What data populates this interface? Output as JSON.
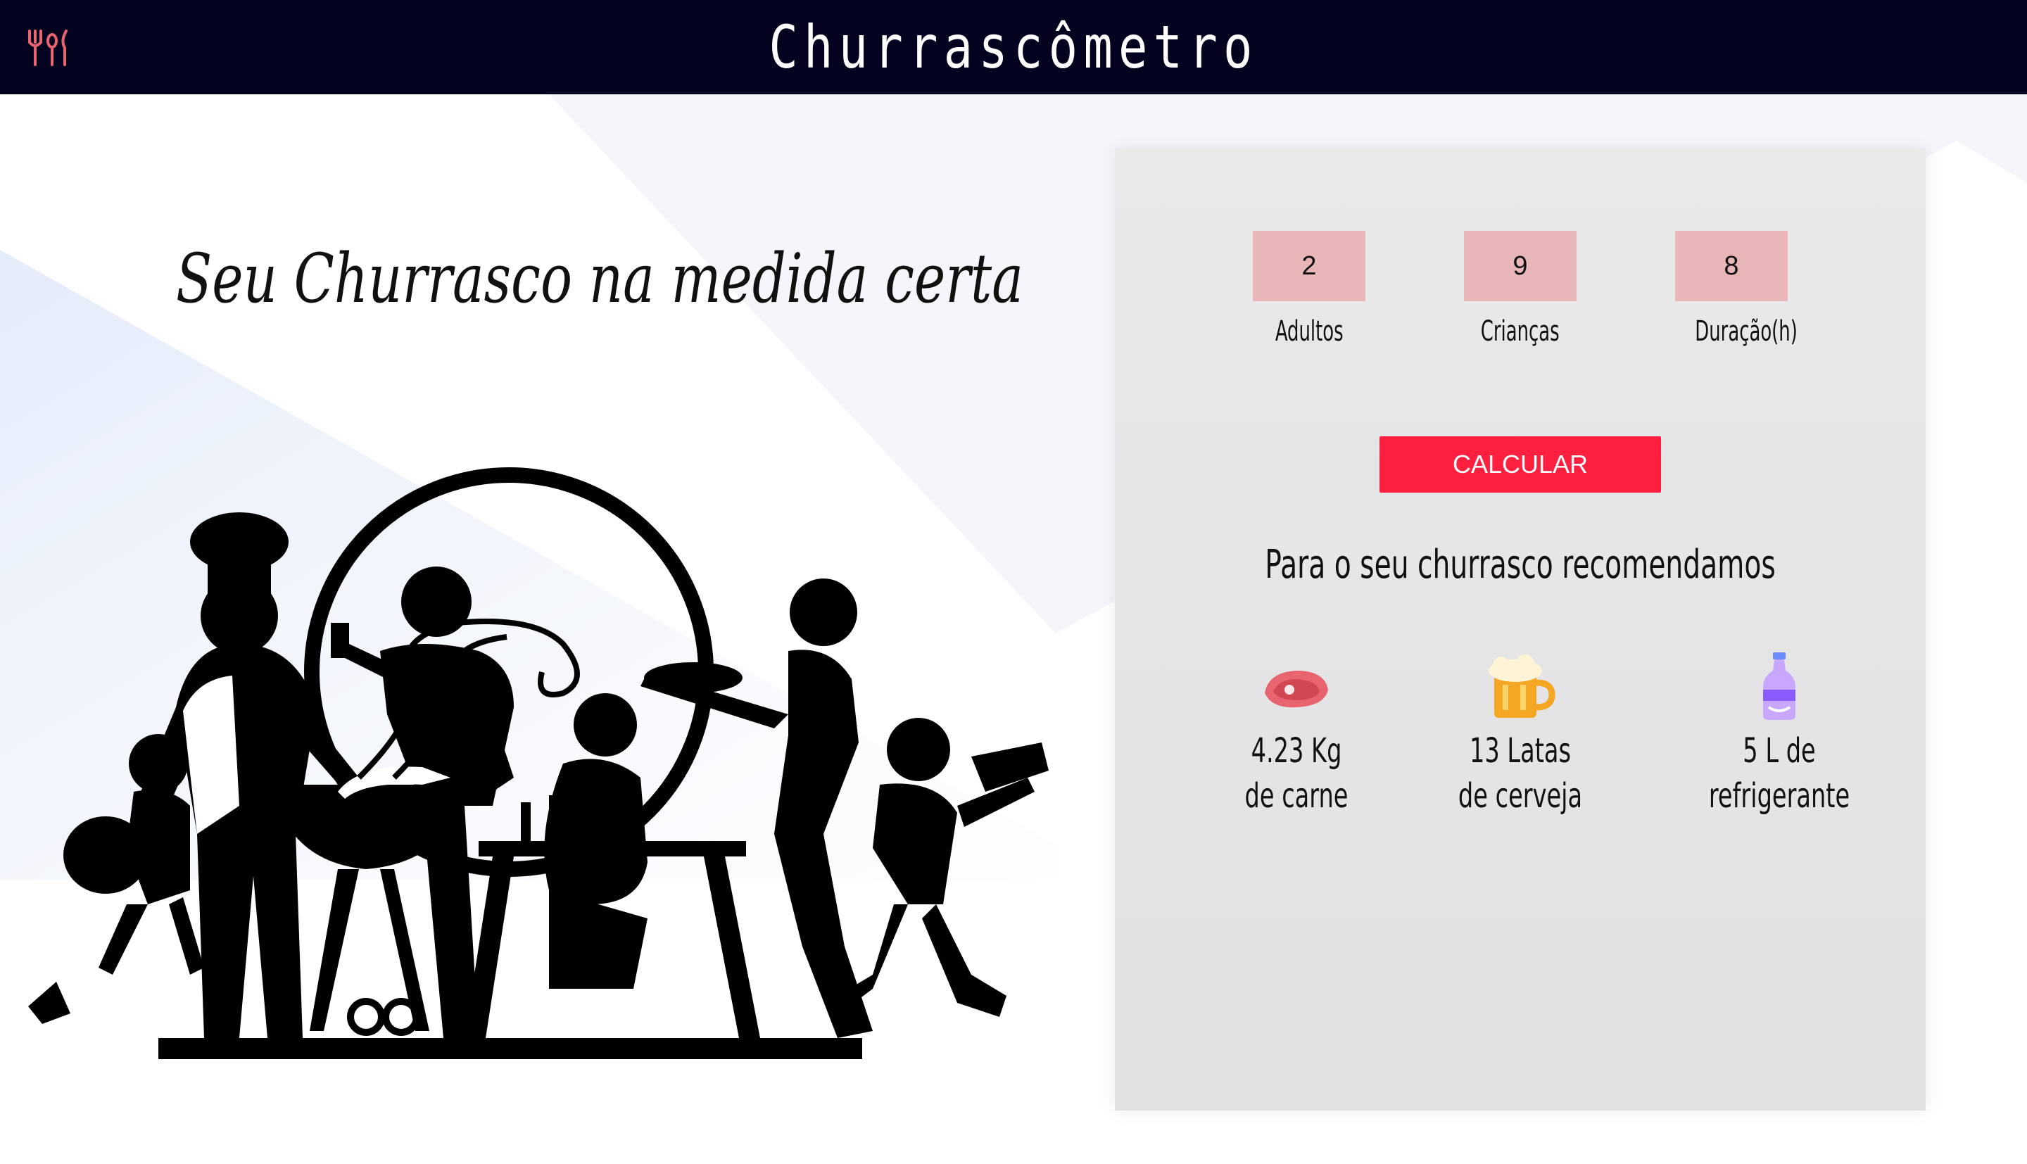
{
  "header": {
    "title": "Churrascômetro",
    "icon": "utensils-icon"
  },
  "hero": {
    "tagline": "Seu Churrasco na medida certa",
    "illustration": "bbq-family-silhouette"
  },
  "calculator": {
    "inputs": [
      {
        "value": "2",
        "label": "Adultos"
      },
      {
        "value": "9",
        "label": "Crianças"
      },
      {
        "value": "8",
        "label": "Duração(h)"
      }
    ],
    "button_label": "CALCULAR",
    "recommend_title": "Para o seu churrasco recomendamos",
    "results": [
      {
        "icon": "meat-icon",
        "line1": "4.23 Kg",
        "line2": "de carne"
      },
      {
        "icon": "beer-mug-icon",
        "line1": "13 Latas",
        "line2": "de cerveja"
      },
      {
        "icon": "soda-bottle-icon",
        "line1": "5 L de",
        "line2": "refrigerante"
      }
    ]
  },
  "colors": {
    "header_bg": "#03021f",
    "input_bg": "#e9b6b8",
    "button_bg": "#ff1f3e",
    "panel_bg": "#e6e6e7",
    "accent_icon": "#e8646f"
  }
}
